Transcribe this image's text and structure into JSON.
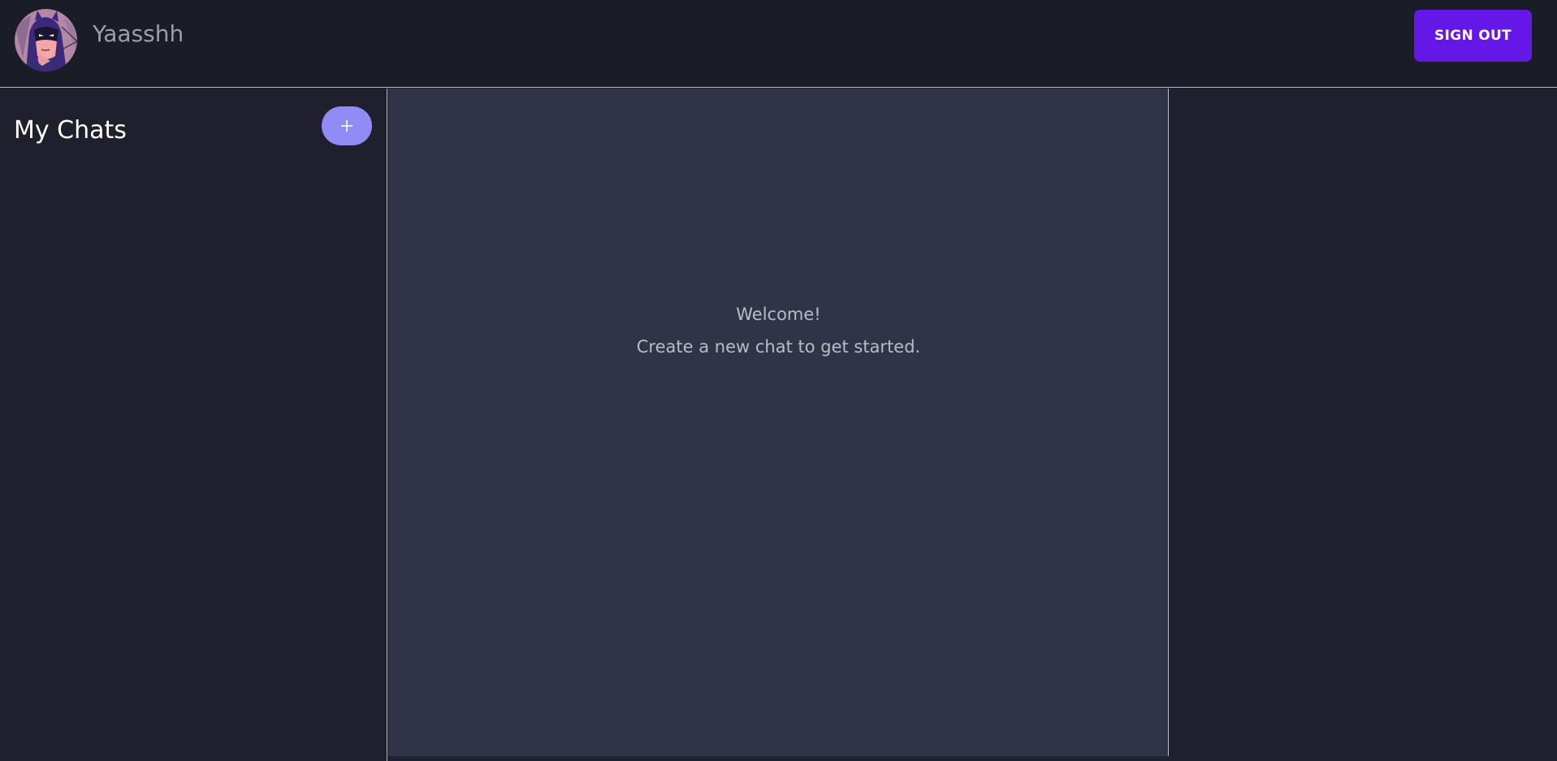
{
  "header": {
    "avatar_icon": "batman-avatar-icon",
    "username": "Yaasshh",
    "signout_label": "SIGN OUT"
  },
  "sidebar": {
    "title": "My Chats",
    "new_chat_icon": "plus-icon"
  },
  "main": {
    "welcome_title": "Welcome!",
    "welcome_subtitle": "Create a new chat to get started."
  },
  "colors": {
    "accent": "#6517e8",
    "new_chat_button": "#918cf5",
    "topbar_bg": "#1a1d26",
    "sidebar_bg": "#1f1f2e",
    "main_bg": "#313348"
  }
}
